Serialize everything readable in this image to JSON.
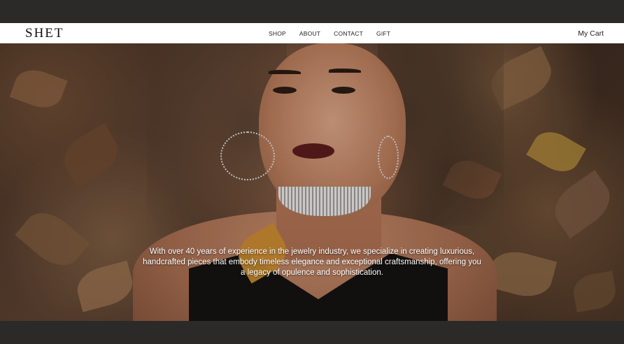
{
  "brand": {
    "logo": "SHET"
  },
  "nav": {
    "links": [
      {
        "label": "SHOP"
      },
      {
        "label": "ABOUT"
      },
      {
        "label": "CONTACT"
      },
      {
        "label": "GIFT"
      }
    ],
    "cart_label": "My Cart"
  },
  "hero": {
    "tagline": "With over 40 years of experience in the jewelry industry, we specialize in creating luxurious, handcrafted pieces that embody timeless elegance and exceptional craftsmanship, offering you a legacy of opulence and sophistication.",
    "image_subject": "woman-with-jewelry-on-autumn-leaves"
  },
  "colors": {
    "chrome": "#2b2a28",
    "nav_bg": "#ffffff",
    "nav_text": "#222222",
    "hero_text": "#ffffff"
  }
}
